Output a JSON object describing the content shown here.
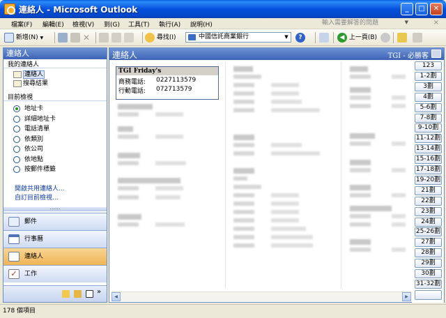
{
  "window": {
    "title": "連絡人 - Microsoft Outlook",
    "minimize": "_",
    "maximize": "□",
    "close": "✕"
  },
  "menu": {
    "items": [
      "檔案(F)",
      "編輯(E)",
      "檢視(V)",
      "到(G)",
      "工具(T)",
      "執行(A)",
      "說明(H)"
    ],
    "ask_placeholder": "輸入需要解答的問題",
    "close_glyph": "×"
  },
  "toolbar": {
    "new_label": "新增(N)",
    "find_label": "尋找(I)",
    "address_book_value": "中國信託商業銀行",
    "back_label": "上一頁(B)"
  },
  "nav": {
    "header": "連絡人",
    "my_contacts_title": "我的連絡人",
    "folders": [
      {
        "label": "連絡人"
      },
      {
        "label": "搜尋結果"
      }
    ],
    "current_view_title": "目前檢視",
    "views": [
      {
        "label": "地址卡",
        "selected": true
      },
      {
        "label": "詳細地址卡",
        "selected": false
      },
      {
        "label": "電話清單",
        "selected": false
      },
      {
        "label": "依類別",
        "selected": false
      },
      {
        "label": "依公司",
        "selected": false
      },
      {
        "label": "依地點",
        "selected": false
      },
      {
        "label": "按郵件標籤",
        "selected": false
      }
    ],
    "links": [
      "開啟共用連絡人...",
      "自訂目前檢視..."
    ],
    "splitter": "......",
    "buttons": [
      {
        "label": "郵件",
        "icon": "mail-icon"
      },
      {
        "label": "行事曆",
        "icon": "calendar-icon"
      },
      {
        "label": "連絡人",
        "icon": "contacts-icon"
      },
      {
        "label": "工作",
        "icon": "tasks-icon"
      }
    ],
    "more_glyph": "»"
  },
  "content": {
    "title": "連絡人",
    "range": "TGI - 必勝客",
    "selected_card": {
      "name": "TGI Friday's",
      "rows": [
        {
          "label": "商務電話:",
          "value": "0227113579"
        },
        {
          "label": "行動電話:",
          "value": "072713579"
        }
      ]
    },
    "index_buttons": [
      "123",
      "1-2劃",
      "3劃",
      "4劃",
      "5-6劃",
      "7-8劃",
      "9-10劃",
      "11-12劃",
      "13-14劃",
      "15-16劃",
      "17-18劃",
      "19-20劃",
      "21劃",
      "22劃",
      "23劃",
      "24劃",
      "25-26劃",
      "27劃",
      "28劃",
      "29劃",
      "30劃",
      "31-32劃"
    ]
  },
  "status": {
    "text": "178 個項目"
  },
  "colors": {
    "titlebar": "#0550dd",
    "pane_header": "#3d63b6",
    "link": "#0c3ba6",
    "selected_nav": "#f0b454"
  }
}
